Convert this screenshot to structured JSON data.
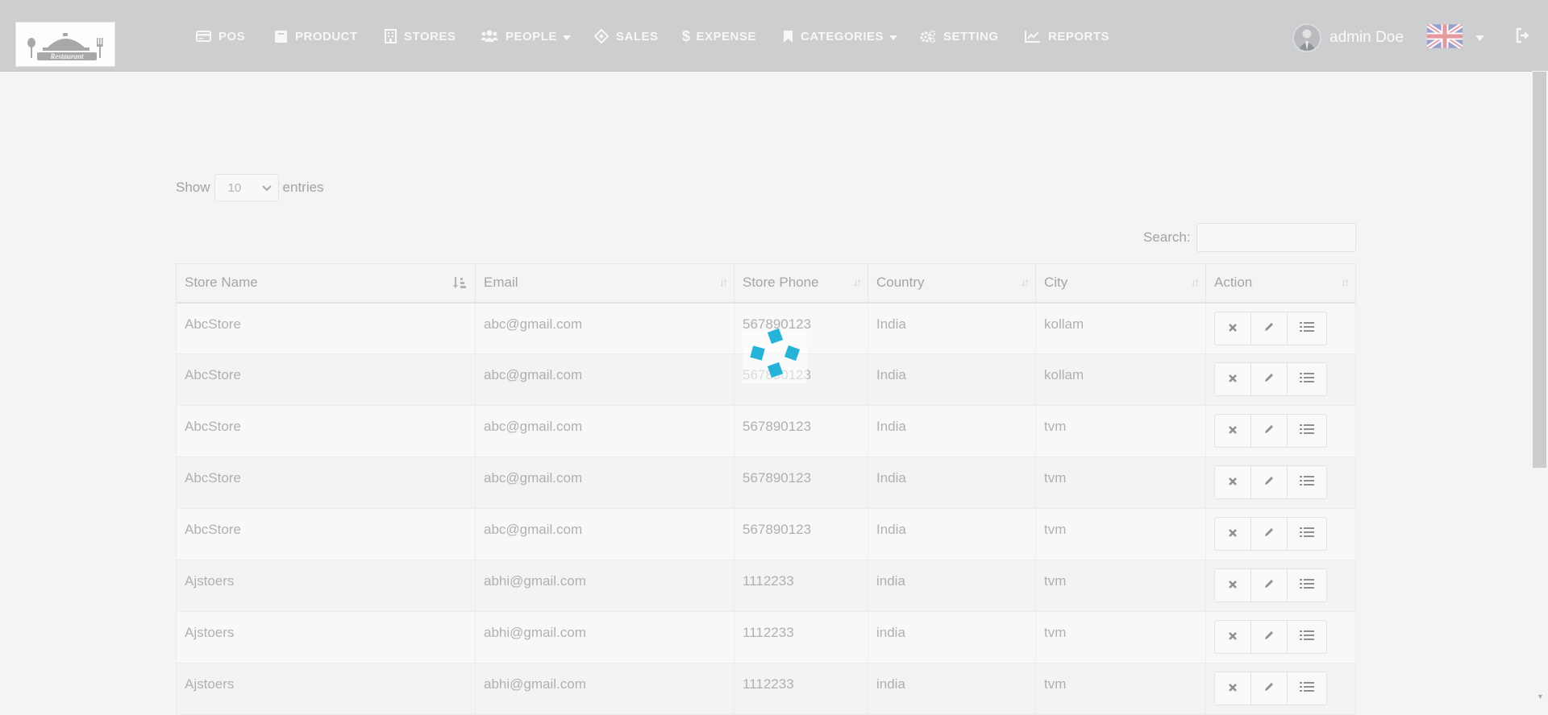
{
  "brand": {
    "logo_text": "Restaurant"
  },
  "nav": {
    "pos": "POS",
    "product": "PRODUCT",
    "stores": "STORES",
    "people": "PEOPLE",
    "sales": "SALES",
    "expense": "EXPENSE",
    "categories": "CATEGORIES",
    "setting": "SETTING",
    "reports": "REPORTS"
  },
  "user": {
    "name": "admin Doe",
    "language_flag": "uk-flag-icon"
  },
  "table_controls": {
    "show_label": "Show",
    "entries_label": "entries",
    "page_length": "10",
    "search_label": "Search:",
    "search_value": ""
  },
  "table": {
    "headers": [
      "Store Name",
      "Email",
      "Store Phone",
      "Country",
      "City",
      "Action"
    ],
    "rows": [
      {
        "store_name": "AbcStore",
        "email": "abc@gmail.com",
        "phone": "567890123",
        "country": "India",
        "city": "kollam"
      },
      {
        "store_name": "AbcStore",
        "email": "abc@gmail.com",
        "phone": "567890123",
        "country": "India",
        "city": "kollam"
      },
      {
        "store_name": "AbcStore",
        "email": "abc@gmail.com",
        "phone": "567890123",
        "country": "India",
        "city": "tvm"
      },
      {
        "store_name": "AbcStore",
        "email": "abc@gmail.com",
        "phone": "567890123",
        "country": "India",
        "city": "tvm"
      },
      {
        "store_name": "AbcStore",
        "email": "abc@gmail.com",
        "phone": "567890123",
        "country": "India",
        "city": "tvm"
      },
      {
        "store_name": "Ajstoers",
        "email": "abhi@gmail.com",
        "phone": "1112233",
        "country": "india",
        "city": "tvm"
      },
      {
        "store_name": "Ajstoers",
        "email": "abhi@gmail.com",
        "phone": "1112233",
        "country": "india",
        "city": "tvm"
      },
      {
        "store_name": "Ajstoers",
        "email": "abhi@gmail.com",
        "phone": "1112233",
        "country": "india",
        "city": "tvm"
      }
    ]
  },
  "colors": {
    "spinner": "#25b3d8",
    "navbar": "#cdcecf"
  }
}
